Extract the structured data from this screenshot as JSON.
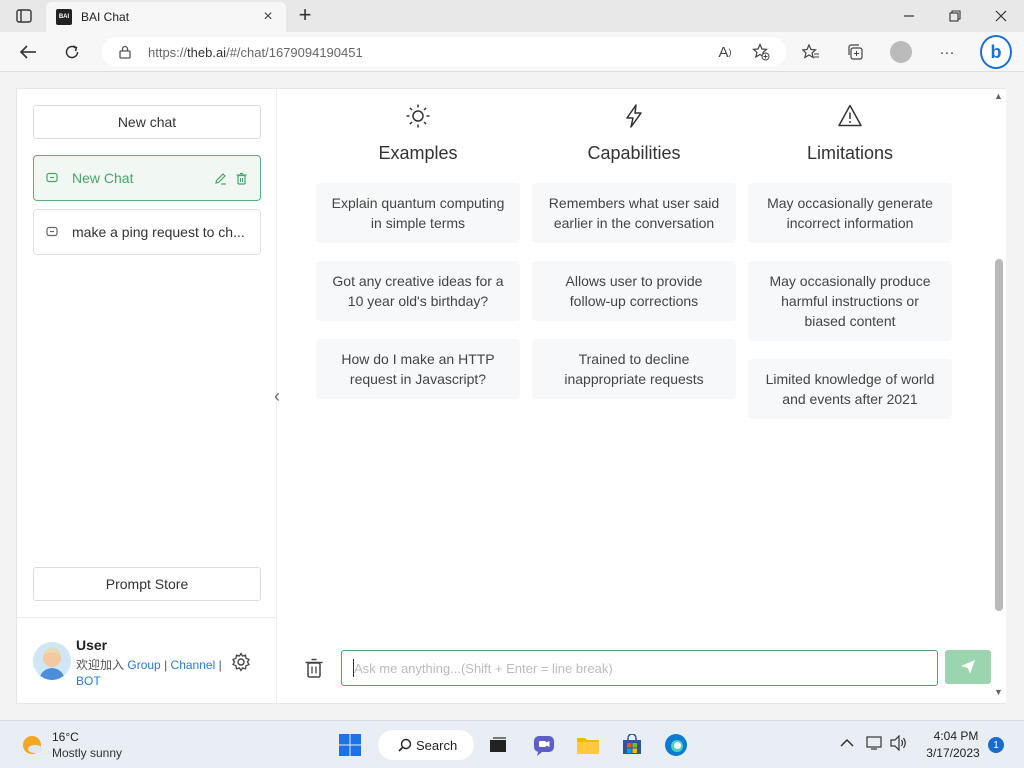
{
  "browser": {
    "tab_title": "BAI Chat",
    "tab_favicon_text": "BAI",
    "url_prefix": "https://",
    "url_host": "theb.ai",
    "url_path": "/#/chat/1679094190451"
  },
  "sidebar": {
    "new_chat_label": "New chat",
    "chats": [
      {
        "label": "New Chat",
        "active": true
      },
      {
        "label": "make a ping request to ch...",
        "active": false
      }
    ],
    "prompt_store_label": "Prompt Store",
    "user": {
      "name": "User",
      "welcome": "欢迎加入",
      "link_group": "Group",
      "sep1": "|",
      "link_channel": "Channel",
      "sep2": "|",
      "link_bot": "BOT"
    }
  },
  "main": {
    "columns": [
      {
        "icon": "sun-icon",
        "title": "Examples",
        "cards": [
          "Explain quantum computing in simple terms",
          "Got any creative ideas for a 10 year old's birthday?",
          "How do I make an HTTP request in Javascript?"
        ]
      },
      {
        "icon": "lightning-icon",
        "title": "Capabilities",
        "cards": [
          "Remembers what user said earlier in the conversation",
          "Allows user to provide follow-up corrections",
          "Trained to decline inappropriate requests"
        ]
      },
      {
        "icon": "warning-icon",
        "title": "Limitations",
        "cards": [
          "May occasionally generate incorrect information",
          "May occasionally produce harmful instructions or biased content",
          "Limited knowledge of world and events after 2021"
        ]
      }
    ],
    "input_placeholder": "Ask me anything...(Shift + Enter = line break)"
  },
  "taskbar": {
    "weather_temp": "16°C",
    "weather_desc": "Mostly sunny",
    "search_label": "Search",
    "time": "4:04 PM",
    "date": "3/17/2023",
    "notification_count": "1"
  },
  "colors": {
    "accent_green": "#48a96d",
    "send_button": "#9ad5b0",
    "link_blue": "#2b7bd5"
  }
}
